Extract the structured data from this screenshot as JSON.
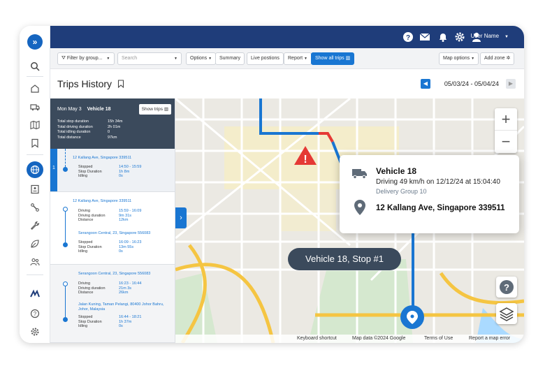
{
  "topbar": {
    "user_name": "User Name"
  },
  "toolbar": {
    "filter_label": "Filter by group...",
    "search_placeholder": "Search",
    "options": "Options",
    "summary": "Summary",
    "live_positions": "Live postions",
    "report": "Report",
    "show_all_trips": "Show all trips",
    "map_options": "Map options",
    "add_zone": "Add zone"
  },
  "page": {
    "title": "Trips History",
    "date_range": "05/03/24 - 05/04/24"
  },
  "panel": {
    "header": {
      "date": "Mon May 3",
      "vehicle": "Vehicle 18",
      "show_trips": "Show trips"
    },
    "stats": [
      {
        "label": "Total stop duration",
        "value": "15h 34m"
      },
      {
        "label": "Total driving duration",
        "value": "2h 01m"
      },
      {
        "label": "Total idling duration",
        "value": "0"
      },
      {
        "label": "Total distance",
        "value": "97km"
      }
    ],
    "selected_index": "1",
    "stop1": {
      "address": "12 Kallang Ave, Singapore 339511",
      "rows": [
        {
          "k": "Stopped",
          "v": "14:50 - 15:59"
        },
        {
          "k": "Stop Duration",
          "v": "1h 8m"
        },
        {
          "k": "Idling",
          "v": "0s"
        }
      ]
    },
    "trip2": {
      "address": "12 Kallang Ave, Singapore 339511",
      "rows": [
        {
          "k": "Driving",
          "v": "15:59 - 16:09"
        },
        {
          "k": "Driving duration",
          "v": "9m 31s"
        },
        {
          "k": "Distance",
          "v": "12km"
        }
      ],
      "address2": "Serangoon Central, 23, Singapore 556083",
      "rows2": [
        {
          "k": "Stopped",
          "v": "16:09 - 16:23"
        },
        {
          "k": "Stop Duration",
          "v": "13m 55s"
        },
        {
          "k": "Idling",
          "v": "0s"
        }
      ]
    },
    "trip3": {
      "address": "Serangoon Central, 23, Singapore 556083",
      "rows": [
        {
          "k": "Driving",
          "v": "16:23 - 16:44"
        },
        {
          "k": "Driving duration",
          "v": "21m 3s"
        },
        {
          "k": "Distance",
          "v": "26km"
        }
      ],
      "address2a": "Jalan Kuning, Taman Pelangi, 80400 Johor Bahru,",
      "address2b": "Johor, Malaysia",
      "rows2": [
        {
          "k": "Stopped",
          "v": "16:44 - 18:21"
        },
        {
          "k": "Stop Duration",
          "v": "1h 37m"
        },
        {
          "k": "Idling",
          "v": "0s"
        }
      ]
    }
  },
  "map": {
    "popup": {
      "vehicle": "Vehicle 18",
      "driving": "Driving 49 km/h on 12/12/24 at 15:04:40",
      "group": "Delivery Group 10",
      "address": "12 Kallang Ave, Singapore 339511"
    },
    "tooltip": "Vehicle 18, Stop #1",
    "zoom_in": "+",
    "zoom_out": "−",
    "footer": {
      "keyboard": "Keyboard shortcut",
      "mapdata": "Map data ©2024 Google",
      "terms": "Terms of Use",
      "report": "Report a map error"
    }
  },
  "colors": {
    "brand": "#1f3d7a",
    "accent": "#1976d2",
    "panel_header": "#3b4a5c",
    "alert": "#e53935"
  }
}
